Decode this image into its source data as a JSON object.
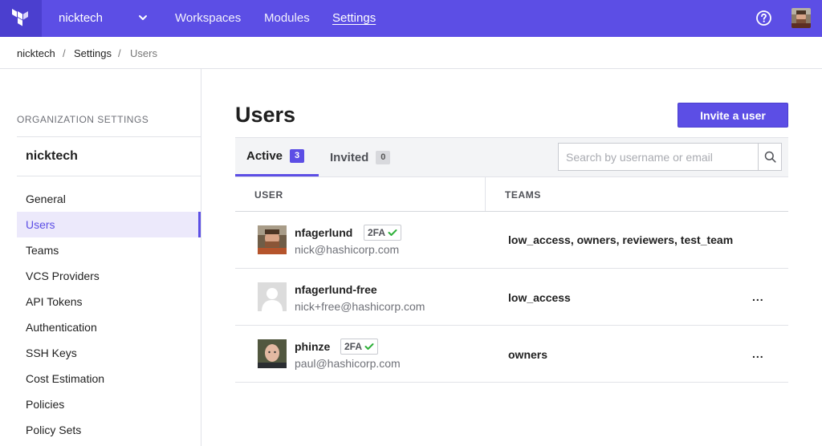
{
  "topnav": {
    "org": "nicktech",
    "links": [
      "Workspaces",
      "Modules",
      "Settings"
    ],
    "active_link": "Settings",
    "logo_icon": "terraform-logo-icon",
    "help_icon": "help-circle-icon",
    "colors": {
      "bar": "#5c4ee5",
      "logo_bg": "#4b3fcf"
    }
  },
  "breadcrumb": {
    "items": [
      "nicktech",
      "Settings",
      "Users"
    ],
    "separator": "/"
  },
  "sidebar": {
    "heading": "ORGANIZATION SETTINGS",
    "org": "nicktech",
    "items": [
      "General",
      "Users",
      "Teams",
      "VCS Providers",
      "API Tokens",
      "Authentication",
      "SSH Keys",
      "Cost Estimation",
      "Policies",
      "Policy Sets"
    ],
    "active_item": "Users"
  },
  "main": {
    "title": "Users",
    "invite_label": "Invite a user",
    "tabs": [
      {
        "label": "Active",
        "count": "3"
      },
      {
        "label": "Invited",
        "count": "0"
      }
    ],
    "active_tab": "Active",
    "search": {
      "placeholder": "Search by username or email",
      "value": ""
    },
    "columns": [
      "USER",
      "TEAMS"
    ],
    "users": [
      {
        "name": "nfagerlund",
        "twofa": "2FA",
        "email": "nick@hashicorp.com",
        "teams": "low_access, owners, reviewers, test_team",
        "more": ""
      },
      {
        "name": "nfagerlund-free",
        "twofa": "",
        "email": "nick+free@hashicorp.com",
        "teams": "low_access",
        "more": "..."
      },
      {
        "name": "phinze",
        "twofa": "2FA",
        "email": "paul@hashicorp.com",
        "teams": "owners",
        "more": "..."
      }
    ]
  }
}
